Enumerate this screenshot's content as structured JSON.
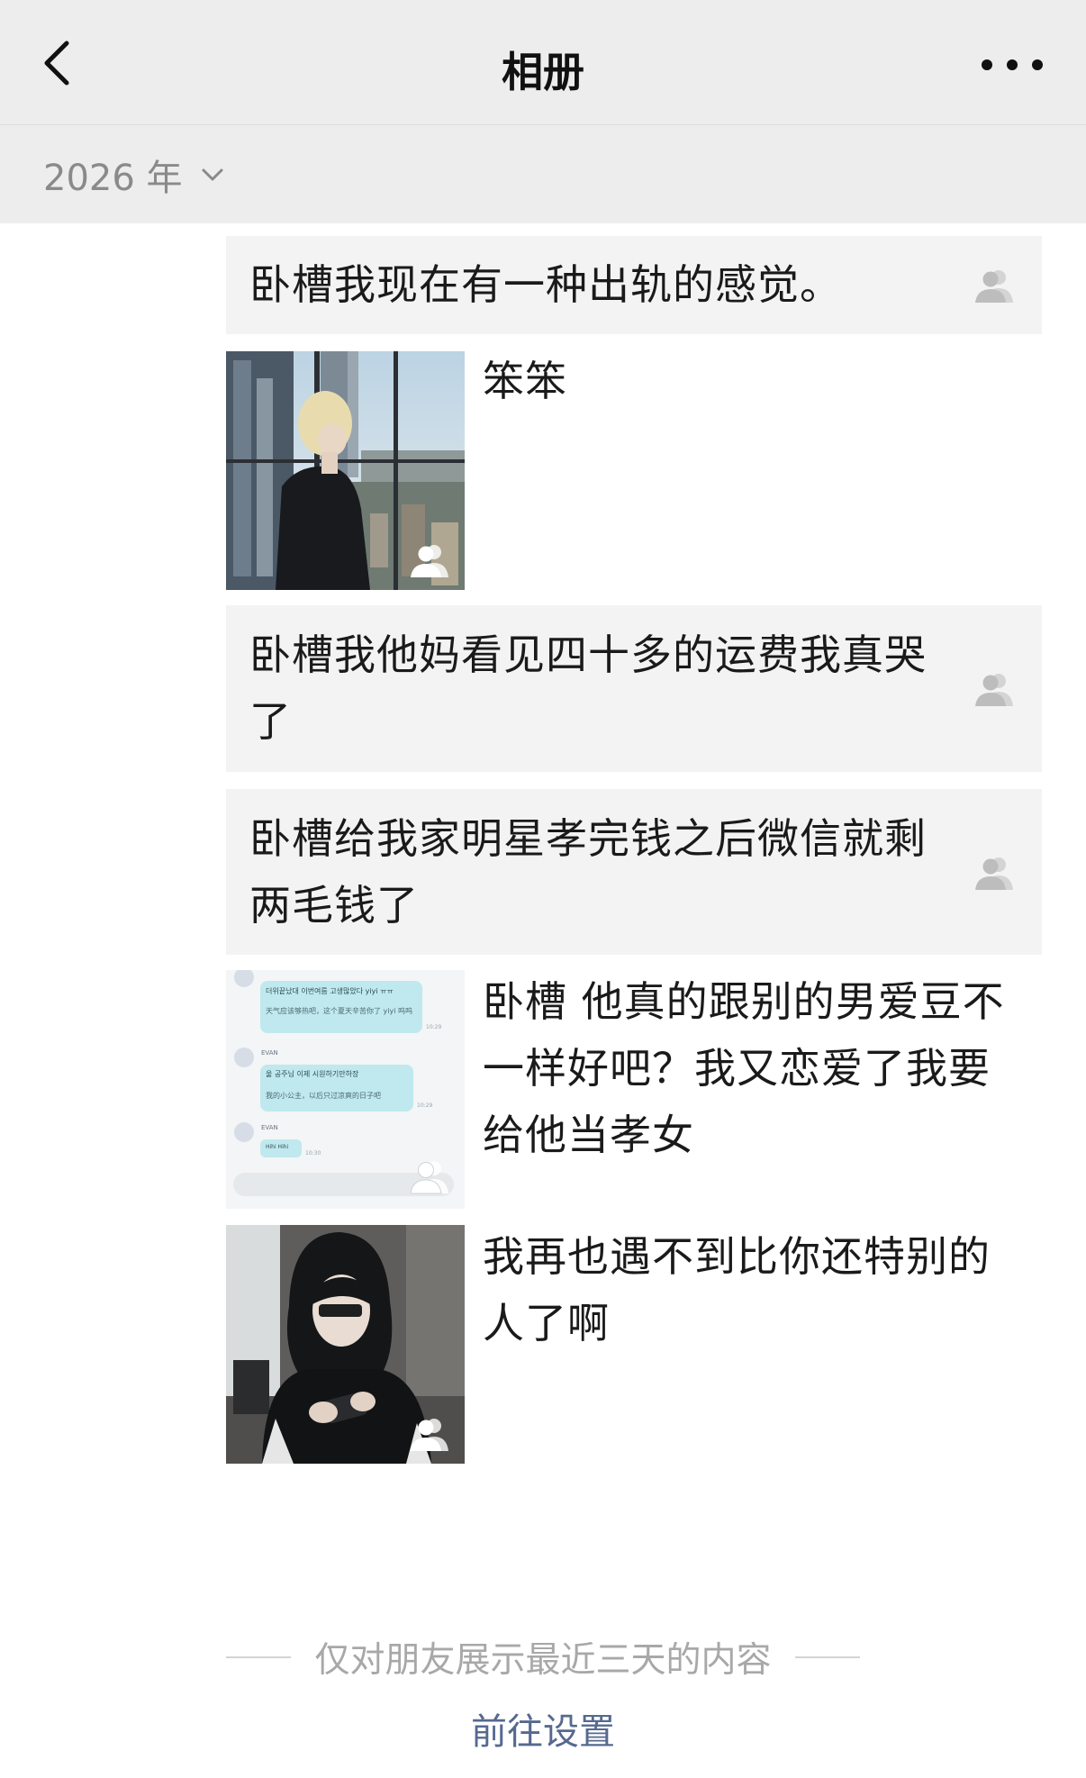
{
  "nav": {
    "title": "相册"
  },
  "year_filter": {
    "label": "2026 年"
  },
  "posts": [
    {
      "type": "text",
      "text": "卧槽我现在有一种出轨的感觉。"
    },
    {
      "type": "photo",
      "caption": "笨笨"
    },
    {
      "type": "text",
      "text": "卧槽我他妈看见四十多的运费我真哭了"
    },
    {
      "type": "text",
      "text": "卧槽给我家明星孝完钱之后微信就剩两毛钱了"
    },
    {
      "type": "photo",
      "caption": "卧槽 他真的跟别的男爱豆不一样好吧？我又恋爱了我要给他当孝女"
    },
    {
      "type": "photo",
      "caption": "我再也遇不到比你还特别的人了啊"
    }
  ],
  "chat_screenshot": {
    "msg1": "더위끝났대 이번여름 고생많았다 yiyi ㅠㅠ",
    "msg1_trans": "天气应该够热吧，这个夏天辛苦你了 yiyi 呜呜",
    "sender": "EVAN",
    "msg2": "울 공주님 이제 시원하기만하장",
    "msg2_trans": "我的小公主，以后只过凉爽的日子吧",
    "msg3": "Hihi Hihi",
    "time1": "10:29",
    "time2": "10:29",
    "time3": "10:30"
  },
  "footer": {
    "note": "仅对朋友展示最近三天的内容",
    "link": "前往设置"
  },
  "colors": {
    "nav_bg": "#ededed",
    "post_bg": "#f3f3f3",
    "link": "#56698f"
  }
}
